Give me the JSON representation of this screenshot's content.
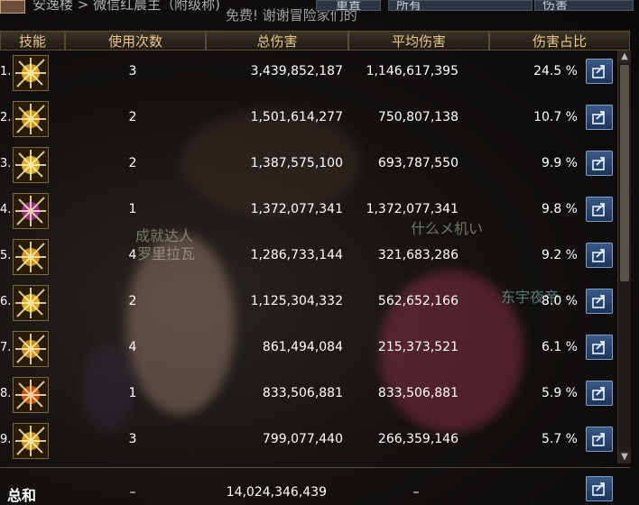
{
  "top": {
    "breadcrumb": "安逸楼 > 微信红晨主（附级称)",
    "notice": "免费! 谢谢冒险家们的",
    "select1": "重置",
    "select2": "所有",
    "select3": "伤害"
  },
  "headers": {
    "skill": "技能",
    "uses": "使用次数",
    "total": "总伤害",
    "avg": "平均伤害",
    "pct": "伤害占比"
  },
  "rows": [
    {
      "rank": "1.",
      "uses": "3",
      "total": "3,439,852,187",
      "avg": "1,146,617,395",
      "pct": "24.5 %",
      "icon_color": "#e8b020"
    },
    {
      "rank": "2.",
      "uses": "2",
      "total": "1,501,614,277",
      "avg": "750,807,138",
      "pct": "10.7 %",
      "icon_color": "#d8a010"
    },
    {
      "rank": "3.",
      "uses": "2",
      "total": "1,387,575,100",
      "avg": "693,787,550",
      "pct": "9.9 %",
      "icon_color": "#f0c030"
    },
    {
      "rank": "4.",
      "uses": "1",
      "total": "1,372,077,341",
      "avg": "1,372,077,341",
      "pct": "9.8 %",
      "icon_color": "#a03090"
    },
    {
      "rank": "5.",
      "uses": "4",
      "total": "1,286,733,144",
      "avg": "321,683,286",
      "pct": "9.2 %",
      "icon_color": "#e0a020"
    },
    {
      "rank": "6.",
      "uses": "2",
      "total": "1,125,304,332",
      "avg": "562,652,166",
      "pct": "8.0 %",
      "icon_color": "#f0b820"
    },
    {
      "rank": "7.",
      "uses": "4",
      "total": "861,494,084",
      "avg": "215,373,521",
      "pct": "6.1 %",
      "icon_color": "#d89818"
    },
    {
      "rank": "8.",
      "uses": "1",
      "total": "833,506,881",
      "avg": "833,506,881",
      "pct": "5.9 %",
      "icon_color": "#e05818"
    },
    {
      "rank": "9.",
      "uses": "3",
      "total": "799,077,440",
      "avg": "266,359,146",
      "pct": "5.7 %",
      "icon_color": "#e0a828"
    }
  ],
  "total": {
    "label": "总和",
    "uses": "–",
    "sum": "14,024,346,439",
    "avg": "–"
  },
  "overlay_texts": [
    "成就达人",
    "罗里拉瓦",
    "东宇夜帝",
    "什么メ机い"
  ]
}
